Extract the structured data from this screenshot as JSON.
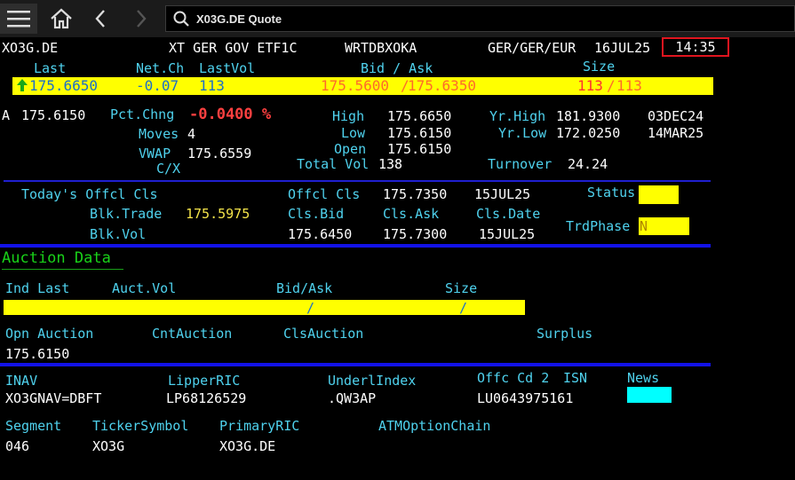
{
  "toolbar": {
    "menu_icon": "hamburger-icon",
    "home_icon": "home-icon",
    "back_icon": "chevron-left-icon",
    "forward_icon": "chevron-right-icon",
    "search_icon": "search-icon",
    "search_value": "X03G.DE Quote"
  },
  "header": {
    "ric": "XO3G.DE",
    "name": "XT GER GOV ETF1C",
    "source": "WRTDBXOKA",
    "exchange": "GER/GER/EUR",
    "date": "16JUL25",
    "time": "14:35"
  },
  "quote": {
    "labels": {
      "last": "Last",
      "netch": "Net.Ch",
      "lastvol": "LastVol",
      "bidask": "Bid / Ask",
      "size": "Size"
    },
    "last": "175.6650",
    "netch": "-0.07",
    "lastvol": "113",
    "bid": "175.5600",
    "ask": "175.6350",
    "bid_size": "113",
    "ask_size": "113",
    "sep": "/"
  },
  "stats": {
    "a_label": "A",
    "a_value": "175.6150",
    "pct_label": "Pct.Chng",
    "pct_value": "-0.0400 %",
    "high_label": "High",
    "high": "175.6650",
    "low_label": "Low",
    "low": "175.6150",
    "open_label": "Open",
    "open": "175.6150",
    "yrhigh_label": "Yr.High",
    "yrhigh": "181.9300",
    "yrhigh_date": "03DEC24",
    "yrlow_label": "Yr.Low",
    "yrlow": "172.0250",
    "yrlow_date": "14MAR25",
    "moves_label": "Moves",
    "moves": "4",
    "vwap_label": "VWAP",
    "vwap": "175.6559",
    "cx_label": "C/X",
    "totalvol_label": "Total Vol",
    "totalvol": "138",
    "turnover_label": "Turnover",
    "turnover": "24.24"
  },
  "official": {
    "todays_label": "Today's Offcl Cls",
    "offcl_label": "Offcl Cls",
    "offcl": "175.7350",
    "offcl_date": "15JUL25",
    "status_label": "Status",
    "blktrade_label": "Blk.Trade",
    "blktrade": "175.5975",
    "clsbid_label": "Cls.Bid",
    "clsask_label": "Cls.Ask",
    "clsdate_label": "Cls.Date",
    "trdphase_label": "TrdPhase",
    "trdphase": "N",
    "blkvol_label": "Blk.Vol",
    "clsbid": "175.6450",
    "clsask": "175.7300",
    "clsdate": "15JUL25"
  },
  "auction": {
    "title": "Auction Data",
    "indlast_label": "Ind Last",
    "auctvol_label": "Auct.Vol",
    "bidask_label": "Bid/Ask",
    "size_label": "Size",
    "sep": "/",
    "opn_label": "Opn Auction",
    "cnt_label": "CntAuction",
    "cls_label": "ClsAuction",
    "surplus_label": "Surplus",
    "opn_value": "175.6150"
  },
  "refs": {
    "inav_label": "INAV",
    "inav": "XO3GNAV=DBFT",
    "lipper_label": "LipperRIC",
    "lipper": "LP68126529",
    "underl_label": "UnderlIndex",
    "underl": ".QW3AP",
    "offc_label": "Offc Cd 2",
    "isn_label": "ISN",
    "isn": "LU0643975161",
    "news_label": "News",
    "segment_label": "Segment",
    "segment": "046",
    "ticker_label": "TickerSymbol",
    "ticker": "XO3G",
    "primary_label": "PrimaryRIC",
    "primary": "XO3G.DE",
    "atm_label": "ATMOptionChain"
  },
  "colors": {
    "background": "#000000",
    "label": "#4fd2ee",
    "value": "#ffffff",
    "highlight_bar": "#ffff00",
    "negative": "#ff4040",
    "section_title": "#19d219",
    "separator": "#1f1fd0",
    "time_box": "#e0141e",
    "news_box": "#00ffff"
  }
}
